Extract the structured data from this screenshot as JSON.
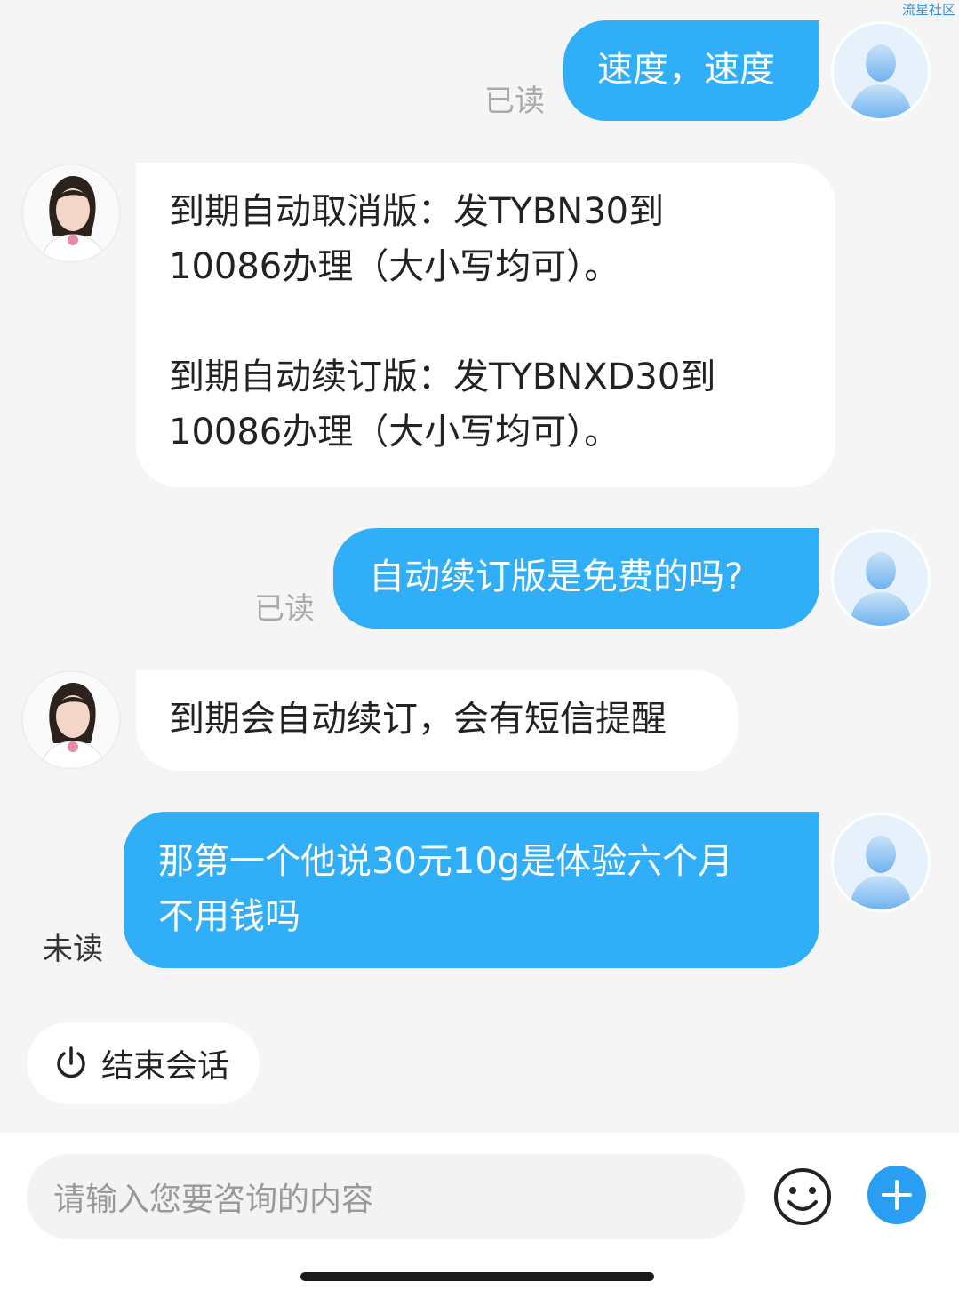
{
  "watermark": "流星社区",
  "messages": [
    {
      "direction": "out",
      "text": "速度，速度",
      "status": "已读"
    },
    {
      "direction": "in",
      "text": "到期自动取消版：发TYBN30到\n10086办理（大小写均可）。\n\n到期自动续订版：发TYBNXD30到\n10086办理（大小写均可）。"
    },
    {
      "direction": "out",
      "text": "自动续订版是免费的吗?",
      "status": "已读"
    },
    {
      "direction": "in",
      "text": "到期会自动续订，会有短信提醒"
    },
    {
      "direction": "out",
      "text": "那第一个他说30元10g是体验六个月\n不用钱吗",
      "status": "未读"
    }
  ],
  "end_chat": {
    "label": "结束会话",
    "icon": "power-icon"
  },
  "input": {
    "placeholder": "请输入您要咨询的内容"
  },
  "icons": {
    "emoji": "smiley-icon",
    "add": "plus-icon",
    "user_avatar": "user-silhouette-icon"
  },
  "colors": {
    "outgoing_bubble": "#30aef7",
    "incoming_bubble": "#ffffff",
    "background": "#f5f5f5",
    "accent": "#2a9ef2"
  }
}
